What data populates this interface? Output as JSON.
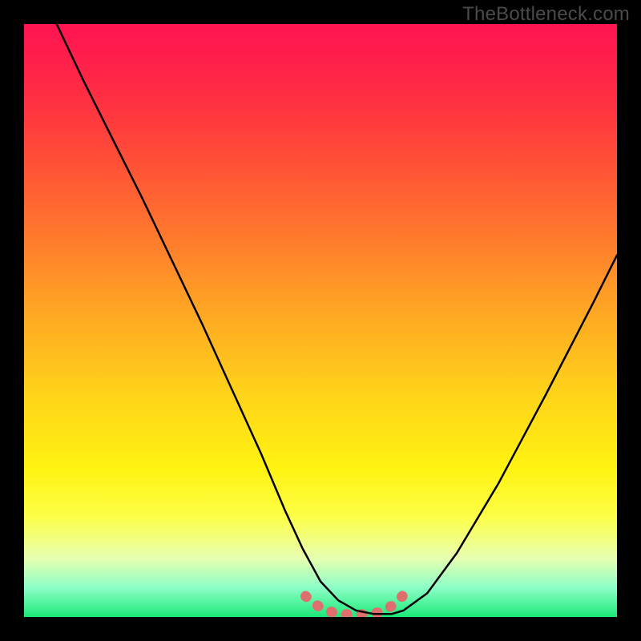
{
  "watermark": "TheBottleneck.com",
  "chart_data": {
    "type": "line",
    "title": "",
    "xlabel": "",
    "ylabel": "",
    "xlim": [
      0,
      1
    ],
    "ylim": [
      0,
      1
    ],
    "gradient_stops": [
      {
        "pos": 0.0,
        "color": "#ff1452"
      },
      {
        "pos": 0.06,
        "color": "#ff1f4b"
      },
      {
        "pos": 0.14,
        "color": "#ff3340"
      },
      {
        "pos": 0.24,
        "color": "#ff5236"
      },
      {
        "pos": 0.36,
        "color": "#ff7a2d"
      },
      {
        "pos": 0.48,
        "color": "#ffa524"
      },
      {
        "pos": 0.62,
        "color": "#ffd21a"
      },
      {
        "pos": 0.75,
        "color": "#fff311"
      },
      {
        "pos": 0.83,
        "color": "#fdff47"
      },
      {
        "pos": 0.9,
        "color": "#e8ffb0"
      },
      {
        "pos": 0.95,
        "color": "#8effc7"
      },
      {
        "pos": 1.0,
        "color": "#1ce978"
      }
    ],
    "series": [
      {
        "name": "main-curve",
        "color": "#000000",
        "width": 2.5,
        "x": [
          0.055,
          0.1,
          0.15,
          0.2,
          0.25,
          0.3,
          0.35,
          0.4,
          0.44,
          0.47,
          0.5,
          0.53,
          0.56,
          0.59,
          0.62,
          0.64,
          0.68,
          0.73,
          0.8,
          0.88,
          0.96,
          1.0
        ],
        "y": [
          1.0,
          0.905,
          0.805,
          0.705,
          0.6,
          0.495,
          0.385,
          0.275,
          0.18,
          0.115,
          0.06,
          0.028,
          0.011,
          0.005,
          0.005,
          0.011,
          0.04,
          0.108,
          0.225,
          0.375,
          0.53,
          0.61
        ]
      },
      {
        "name": "trough-marker",
        "color": "#df6f6f",
        "width": 13,
        "x": [
          0.475,
          0.49,
          0.505,
          0.52,
          0.535,
          0.55,
          0.565,
          0.58,
          0.595,
          0.61,
          0.625,
          0.64
        ],
        "y": [
          0.035,
          0.022,
          0.013,
          0.008,
          0.005,
          0.004,
          0.004,
          0.005,
          0.007,
          0.012,
          0.022,
          0.037
        ]
      }
    ]
  }
}
